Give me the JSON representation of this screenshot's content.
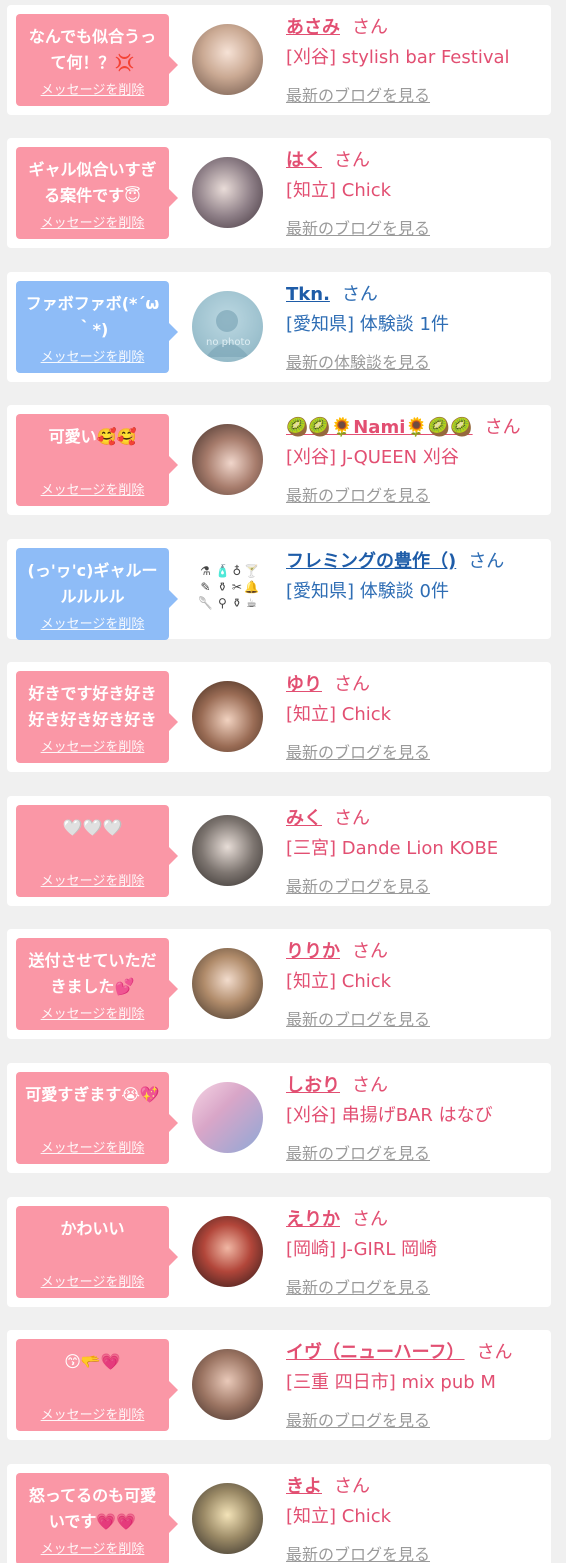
{
  "colors": {
    "pink_bubble": "#fa97a6",
    "blue_bubble": "#8ebcf7",
    "pink_text": "#e24f72",
    "blue_text": "#2e6db4",
    "link_gray": "#9a9a9a"
  },
  "messages": [
    {
      "text": "なんでも似合うって何！？💢",
      "delete_label": "メッセージを削除",
      "name": "あさみ",
      "suffix": "さん",
      "shop": "[刈谷] stylish bar Festival",
      "link": "最新のブログを見る",
      "theme": "pink",
      "avatar_icon": "photo-avatar"
    },
    {
      "text": "ギャル似合いすぎる案件です😇",
      "delete_label": "メッセージを削除",
      "name": "はく",
      "suffix": "さん",
      "shop": "[知立] Chick",
      "link": "最新のブログを見る",
      "theme": "pink",
      "avatar_icon": "photo-avatar"
    },
    {
      "text": "ファボファボ(*´ω｀*)",
      "delete_label": "メッセージを削除",
      "name": "Tkn.",
      "suffix": "さん",
      "shop": "[愛知県] 体験談 1件",
      "link": "最新の体験談を見る",
      "theme": "blue",
      "avatar_icon": "no-photo-avatar",
      "avatar_caption": "no photo"
    },
    {
      "text": "可愛い🥰🥰",
      "delete_label": "メッセージを削除",
      "name": "🥝🥝🌻Nami🌻🥝🥝",
      "suffix": "さん",
      "shop": "[刈谷] J-QUEEN 刈谷",
      "link": "最新のブログを見る",
      "theme": "pink",
      "avatar_icon": "photo-avatar"
    },
    {
      "text": "(っ'ヮ'c)ギャルールルルル",
      "delete_label": "メッセージを削除",
      "name": "フレミングの豊作（)",
      "suffix": "さん",
      "shop": "[愛知県] 体験談 0件",
      "link": "",
      "theme": "blue",
      "avatar_icon": "icon-grid-avatar"
    },
    {
      "text": "好きです好き好き好き好き好き好き好",
      "delete_label": "メッセージを削除",
      "name": "ゆり",
      "suffix": "さん",
      "shop": "[知立] Chick",
      "link": "最新のブログを見る",
      "theme": "pink",
      "avatar_icon": "photo-avatar"
    },
    {
      "text": "🤍🤍🤍",
      "delete_label": "メッセージを削除",
      "name": "みく",
      "suffix": "さん",
      "shop": "[三宮] Dande Lion KOBE",
      "link": "最新のブログを見る",
      "theme": "pink",
      "avatar_icon": "photo-avatar"
    },
    {
      "text": "送付させていただきました💕",
      "delete_label": "メッセージを削除",
      "name": "りりか",
      "suffix": "さん",
      "shop": "[知立] Chick",
      "link": "最新のブログを見る",
      "theme": "pink",
      "avatar_icon": "photo-avatar"
    },
    {
      "text": "可愛すぎます😭💖",
      "delete_label": "メッセージを削除",
      "name": "しおり",
      "suffix": "さん",
      "shop": "[刈谷] 串揚げBAR はなび",
      "link": "最新のブログを見る",
      "theme": "pink",
      "avatar_icon": "photo-avatar"
    },
    {
      "text": "かわいい",
      "delete_label": "メッセージを削除",
      "name": "えりか",
      "suffix": "さん",
      "shop": "[岡崎] J-GIRL 岡崎",
      "link": "最新のブログを見る",
      "theme": "pink",
      "avatar_icon": "photo-avatar"
    },
    {
      "text": "😙🫳💗",
      "delete_label": "メッセージを削除",
      "name": "イヴ（ニューハーフ）",
      "suffix": "さん",
      "shop": "[三重 四日市] mix pub M",
      "link": "最新のブログを見る",
      "theme": "pink",
      "avatar_icon": "photo-avatar"
    },
    {
      "text": "怒ってるのも可愛いです💗💗",
      "delete_label": "メッセージを削除",
      "name": "きよ",
      "suffix": "さん",
      "shop": "[知立] Chick",
      "link": "最新のブログを見る",
      "theme": "pink",
      "avatar_icon": "photo-avatar"
    }
  ]
}
